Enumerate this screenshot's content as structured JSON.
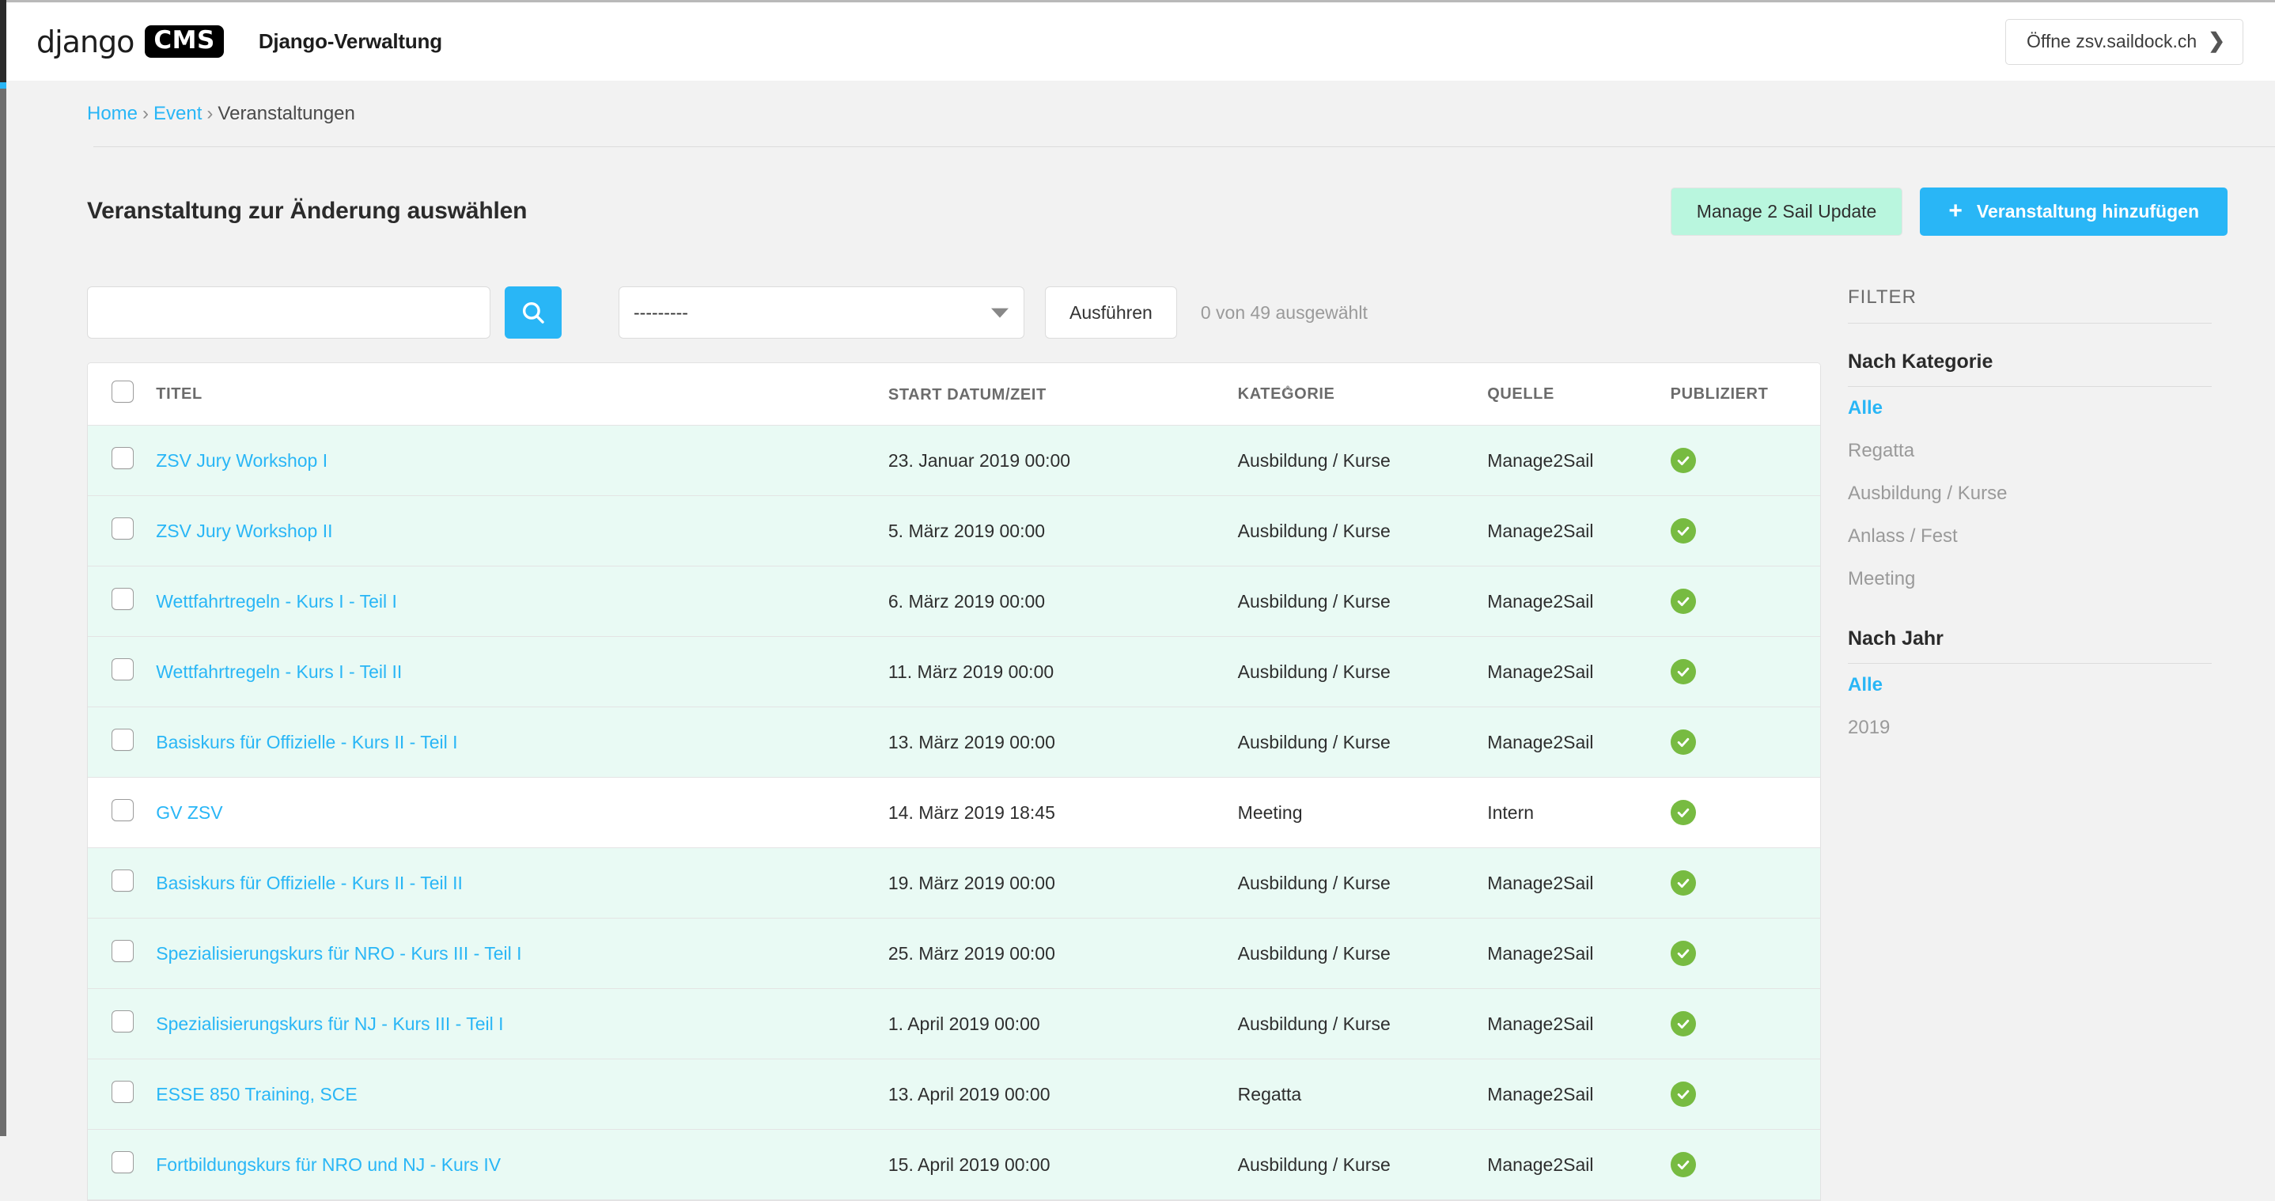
{
  "header": {
    "brand_django": "django",
    "brand_cms": "CMS",
    "admin_title": "Django-Verwaltung",
    "open_site_label": "Öffne zsv.saildock.ch",
    "open_site_chevron": "❯"
  },
  "breadcrumb": {
    "home": "Home",
    "app": "Event",
    "current": "Veranstaltungen",
    "separator": "›"
  },
  "page": {
    "title": "Veranstaltung zur Änderung auswählen",
    "manage_update_label": "Manage 2 Sail Update",
    "add_label": "Veranstaltung hinzufügen",
    "add_icon": "+"
  },
  "toolbar": {
    "search_value": "",
    "search_placeholder": "",
    "search_icon": "search-icon",
    "action_selected": "---------",
    "action_options": [
      "---------"
    ],
    "run_label": "Ausführen",
    "selection_count": "0 von 49 ausgewählt"
  },
  "table": {
    "columns": {
      "title": "TITEL",
      "start": "START DATUM/ZEIT",
      "category": "KATEGORIE",
      "source": "QUELLE",
      "published": "PUBLIZIERT"
    },
    "sort_caret": "^",
    "rows": [
      {
        "title": "ZSV Jury Workshop I",
        "start": "23. Januar 2019 00:00",
        "category": "Ausbildung / Kurse",
        "source": "Manage2Sail",
        "published": true
      },
      {
        "title": "ZSV Jury Workshop II",
        "start": "5. März 2019 00:00",
        "category": "Ausbildung / Kurse",
        "source": "Manage2Sail",
        "published": true
      },
      {
        "title": "Wettfahrtregeln - Kurs I - Teil I",
        "start": "6. März 2019 00:00",
        "category": "Ausbildung / Kurse",
        "source": "Manage2Sail",
        "published": true
      },
      {
        "title": "Wettfahrtregeln - Kurs I - Teil II",
        "start": "11. März 2019 00:00",
        "category": "Ausbildung / Kurse",
        "source": "Manage2Sail",
        "published": true
      },
      {
        "title": "Basiskurs für Offizielle - Kurs II - Teil I",
        "start": "13. März 2019 00:00",
        "category": "Ausbildung / Kurse",
        "source": "Manage2Sail",
        "published": true
      },
      {
        "title": "GV ZSV",
        "start": "14. März 2019 18:45",
        "category": "Meeting",
        "source": "Intern",
        "published": true
      },
      {
        "title": "Basiskurs für Offizielle - Kurs II - Teil II",
        "start": "19. März 2019 00:00",
        "category": "Ausbildung / Kurse",
        "source": "Manage2Sail",
        "published": true
      },
      {
        "title": "Spezialisierungskurs für NRO - Kurs III - Teil I",
        "start": "25. März 2019 00:00",
        "category": "Ausbildung / Kurse",
        "source": "Manage2Sail",
        "published": true
      },
      {
        "title": "Spezialisierungskurs für NJ - Kurs III - Teil I",
        "start": "1. April 2019 00:00",
        "category": "Ausbildung / Kurse",
        "source": "Manage2Sail",
        "published": true
      },
      {
        "title": "ESSE 850 Training, SCE",
        "start": "13. April 2019 00:00",
        "category": "Regatta",
        "source": "Manage2Sail",
        "published": true
      },
      {
        "title": "Fortbildungskurs für NRO und NJ - Kurs IV",
        "start": "15. April 2019 00:00",
        "category": "Ausbildung / Kurse",
        "source": "Manage2Sail",
        "published": true
      }
    ]
  },
  "filter": {
    "heading": "FILTER",
    "groups": [
      {
        "title": "Nach Kategorie",
        "items": [
          {
            "label": "Alle",
            "selected": true
          },
          {
            "label": "Regatta",
            "selected": false
          },
          {
            "label": "Ausbildung / Kurse",
            "selected": false
          },
          {
            "label": "Anlass / Fest",
            "selected": false
          },
          {
            "label": "Meeting",
            "selected": false
          }
        ]
      },
      {
        "title": "Nach Jahr",
        "items": [
          {
            "label": "Alle",
            "selected": true
          },
          {
            "label": "2019",
            "selected": false
          }
        ]
      }
    ]
  },
  "colors": {
    "accent_blue": "#29b6f6",
    "mint_button": "#b9f6de",
    "row_alt": "#e9faf4",
    "published_green": "#77bb41"
  }
}
